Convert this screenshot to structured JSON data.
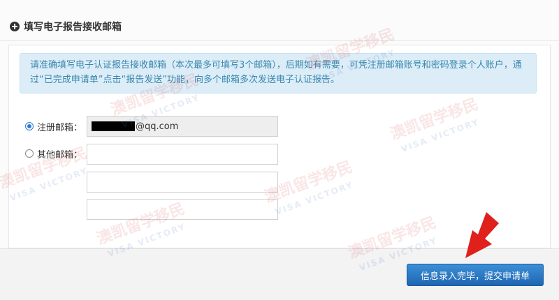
{
  "section": {
    "title": "填写电子报告接收邮箱",
    "icon": "plus-circle-icon"
  },
  "notice": {
    "text": "请准确填写电子认证报告接收邮箱（本次最多可填写3个邮箱），后期如有需要，可凭注册邮箱账号和密码登录个人账户，通过“已完成申请单”点击“报告发送”功能，向多个邮箱多次发送电子认证报告。"
  },
  "options": {
    "registered": {
      "label": "注册邮箱：",
      "selected": true,
      "value_suffix": "@qq.com"
    },
    "other": {
      "label": "其他邮箱：",
      "selected": false,
      "fields": [
        "",
        "",
        ""
      ]
    }
  },
  "actions": {
    "submit_label": "信息录入完毕，提交申请单"
  },
  "watermark": {
    "text": "澳凯留学移民",
    "sub": "VISA VICTORY"
  },
  "colors": {
    "accent": "#1f66b3",
    "notice_bg": "#dcedf8",
    "notice_text": "#3a87ad",
    "arrow": "#e0201b"
  }
}
